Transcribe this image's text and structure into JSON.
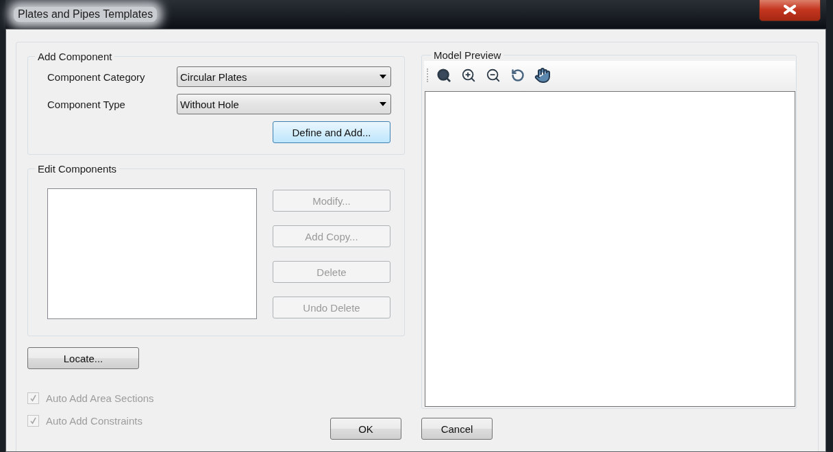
{
  "window": {
    "title": "Plates and Pipes Templates"
  },
  "add_component": {
    "title": "Add Component",
    "fields": [
      {
        "label": "Component Category",
        "value": "Circular Plates"
      },
      {
        "label": "Component Type",
        "value": "Without Hole"
      }
    ],
    "button": {
      "label": "Define and Add...",
      "focused": true
    }
  },
  "edit_components": {
    "title": "Edit Components",
    "buttons": [
      {
        "label": "Modify...",
        "disabled": true
      },
      {
        "label": "Add Copy...",
        "disabled": true
      },
      {
        "label": "Delete",
        "disabled": true
      },
      {
        "label": "Undo Delete",
        "disabled": true
      }
    ]
  },
  "locate_button": "Locate...",
  "options": [
    {
      "label": "Auto Add Area Sections",
      "checked": true,
      "disabled": true
    },
    {
      "label": "Auto Add Constraints",
      "checked": true,
      "disabled": true
    }
  ],
  "model_preview": {
    "title": "Model Preview"
  },
  "buttons": [
    "OK",
    "Cancel"
  ]
}
